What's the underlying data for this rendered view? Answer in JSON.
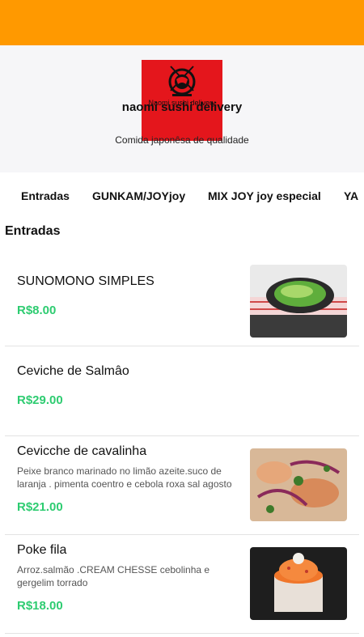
{
  "store": {
    "logo_caption": "Naomi sushi delivery",
    "logo_mark_text": "JOONUS",
    "name": "naomi sushi delivery",
    "tagline": "Comida japonêsa de qualidade"
  },
  "colors": {
    "topbar": "#ff9900",
    "logo_bg": "#e4161c",
    "price": "#2ecc71"
  },
  "tabs": [
    "Entradas",
    "GUNKAM/JOYjoy",
    "MIX JOY joy especial",
    "YA"
  ],
  "section": {
    "title": "Entradas"
  },
  "items": [
    {
      "name": "SUNOMONO SIMPLES",
      "description": "",
      "price": "R$8.00"
    },
    {
      "name": "Ceviche de Salmâo",
      "description": "",
      "price": "R$29.00"
    },
    {
      "name": "Cevicche de cavalinha",
      "description": "Peixe branco marinado no limão azeite.suco de laranja . pimenta coentro e cebola roxa sal agosto",
      "price": "R$21.00"
    },
    {
      "name": "Poke fila",
      "description": "Arroz.salmão .CREAM CHESSE cebolinha e gergelim torrado",
      "price": "R$18.00"
    }
  ]
}
